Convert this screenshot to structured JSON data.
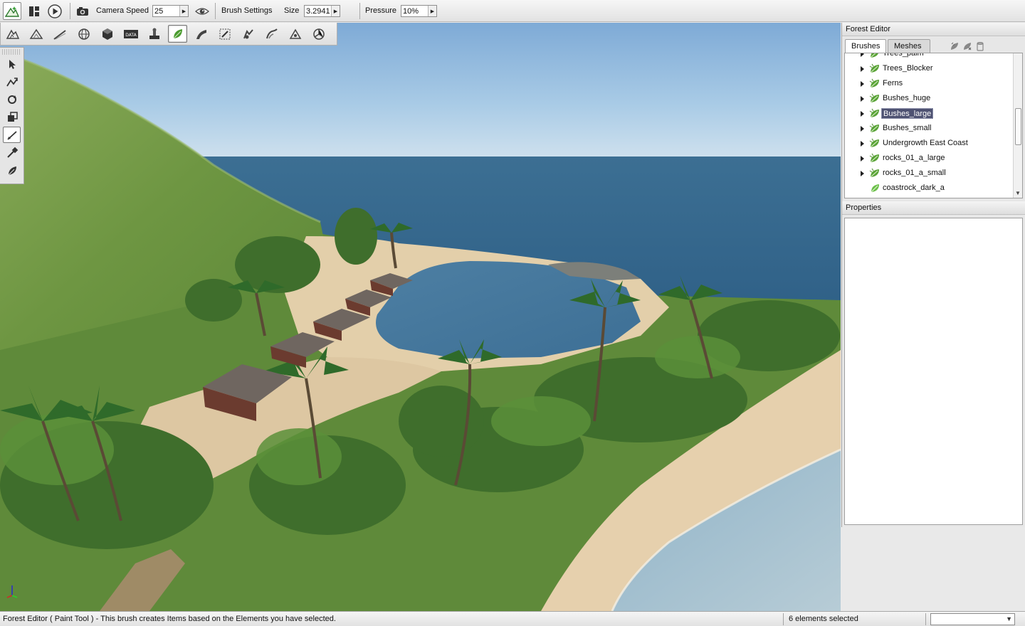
{
  "top_toolbar": {
    "camera_speed_label": "Camera Speed",
    "camera_speed_value": "25",
    "brush_settings_label": "Brush Settings",
    "size_label": "Size",
    "size_value": "3.2941",
    "pressure_label": "Pressure",
    "pressure_value": "10%"
  },
  "forest_editor": {
    "title": "Forest Editor",
    "tabs": [
      {
        "label": "Brushes",
        "active": true
      },
      {
        "label": "Meshes",
        "active": false
      }
    ],
    "brushes": [
      {
        "label": "Trees_palm",
        "expandable": true,
        "selected": false
      },
      {
        "label": "Trees_Blocker",
        "expandable": true,
        "selected": false
      },
      {
        "label": "Ferns",
        "expandable": true,
        "selected": false
      },
      {
        "label": "Bushes_huge",
        "expandable": true,
        "selected": false
      },
      {
        "label": "Bushes_large",
        "expandable": true,
        "selected": true
      },
      {
        "label": "Bushes_small",
        "expandable": true,
        "selected": false
      },
      {
        "label": "Undergrowth East Coast",
        "expandable": true,
        "selected": false
      },
      {
        "label": "rocks_01_a_large",
        "expandable": true,
        "selected": false
      },
      {
        "label": "rocks_01_a_small",
        "expandable": true,
        "selected": false
      },
      {
        "label": "coastrock_dark_a",
        "expandable": false,
        "selected": false
      }
    ]
  },
  "properties": {
    "title": "Properties"
  },
  "status_bar": {
    "message": "Forest Editor ( Paint Tool ) - This brush creates Items based on the Elements you have selected.",
    "selection_count": "6 elements selected",
    "dropdown_value": ""
  },
  "icons": {
    "top": [
      "editor-mode-icon",
      "window-layout-icon",
      "play-icon",
      "camera-icon",
      "visibility-eye-icon"
    ],
    "tools": [
      "terrain-editor-icon",
      "terrain-painter-icon",
      "road-editor-icon",
      "world-editor-icon",
      "object-editor-icon",
      "datablock-editor-icon",
      "decal-editor-icon",
      "forest-editor-icon",
      "mesh-road-icon",
      "river-editor-icon",
      "navmesh-icon",
      "convex-editor-icon",
      "particle-editor-icon"
    ],
    "palette": [
      "select-arrow-icon",
      "move-item-icon",
      "rotate-item-icon",
      "scale-item-icon",
      "paint-brush-icon",
      "erase-brush-icon",
      "erase-selected-icon"
    ]
  },
  "colors": {
    "selection": "#4e5272",
    "panel_bg": "#e7e7e7"
  }
}
